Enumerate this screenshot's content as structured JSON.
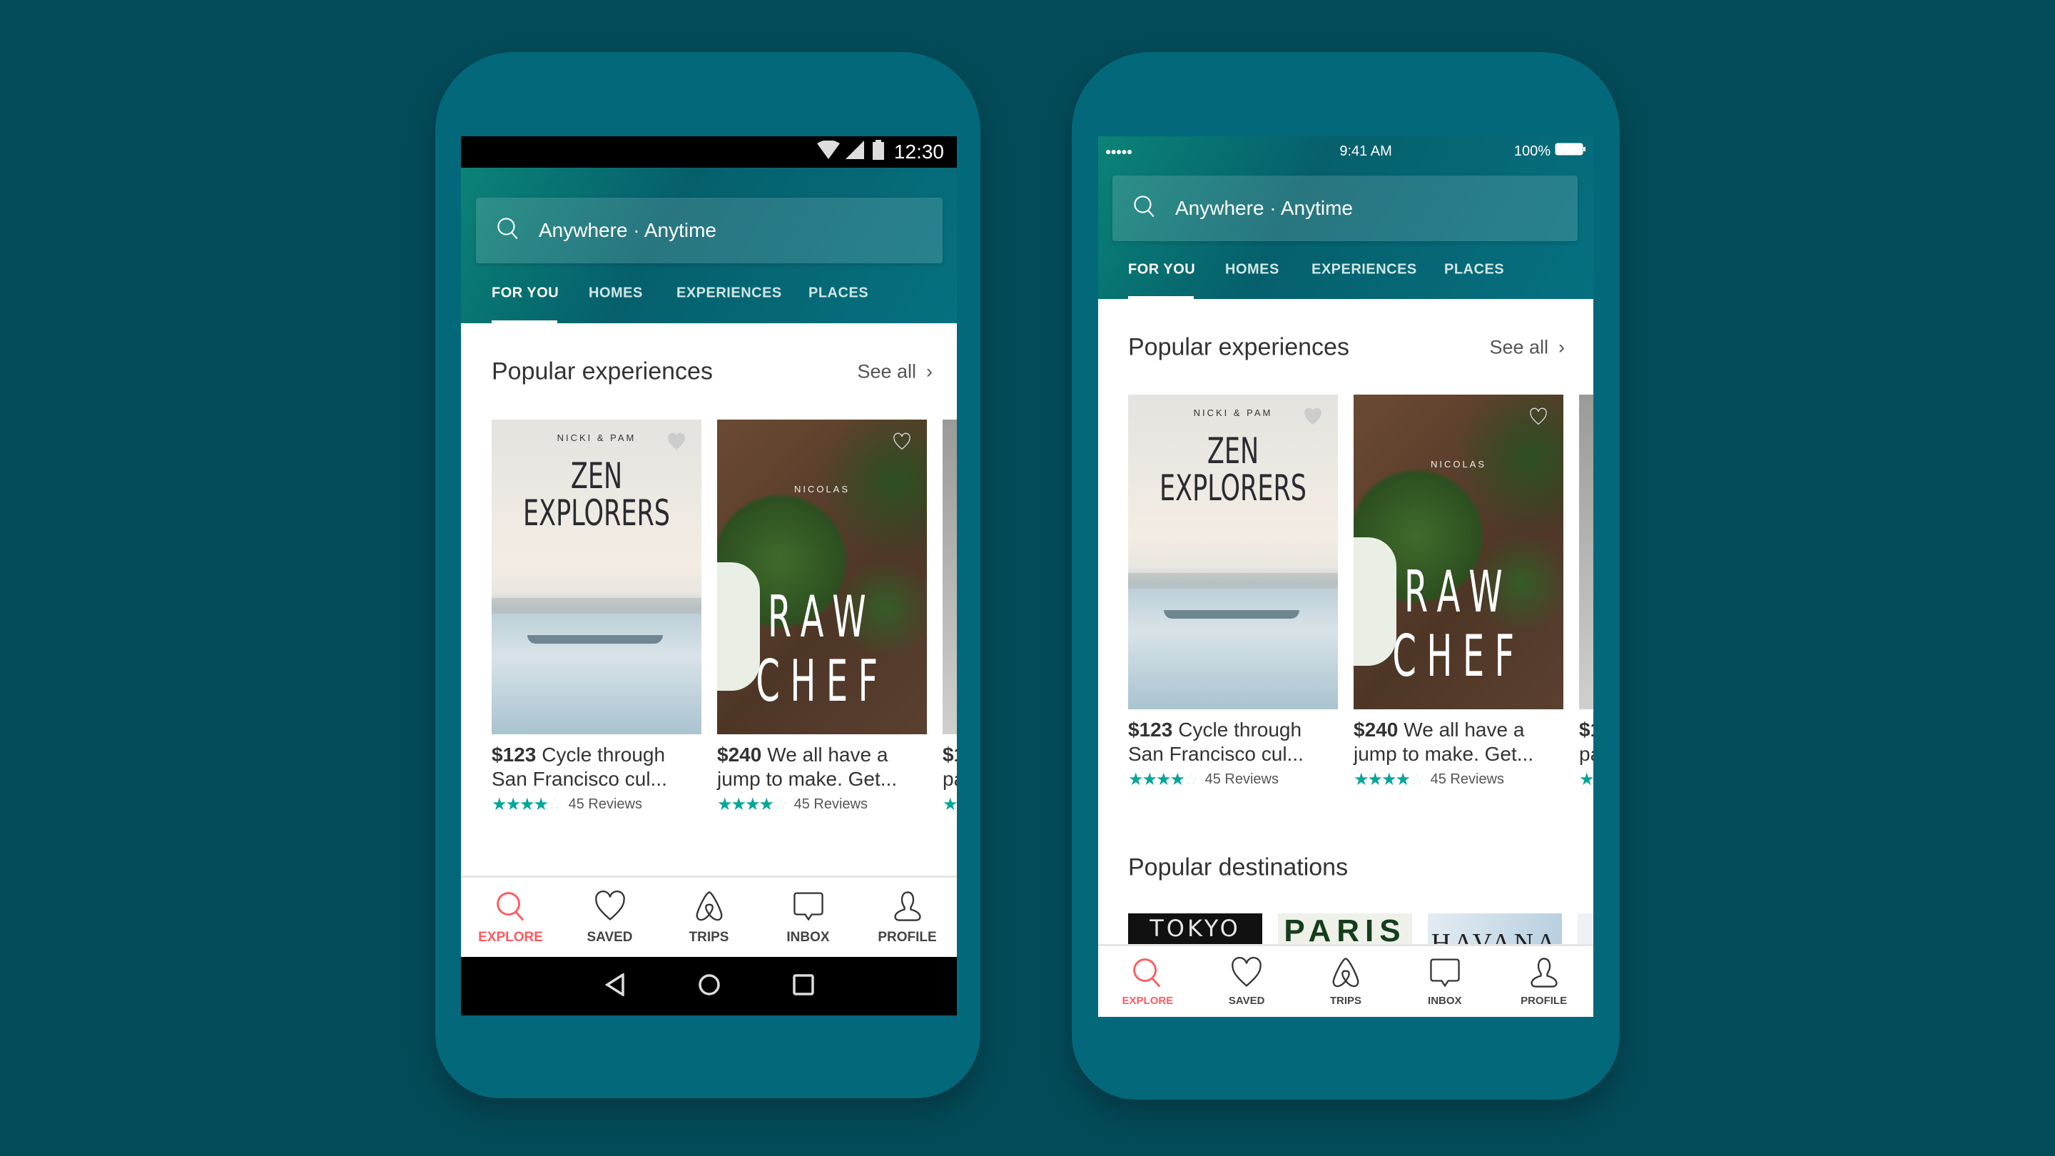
{
  "colors": {
    "background": "#044b59",
    "phone_body": "#03687a",
    "accent_teal": "#00a699",
    "explore_red": "#ff5a5f"
  },
  "android": {
    "status": {
      "time": "12:30",
      "icons": [
        "wifi-icon",
        "signal-icon",
        "battery-icon"
      ]
    },
    "search": {
      "placeholder": "Anywhere · Anytime"
    },
    "tabs": [
      {
        "label": "FOR YOU",
        "active": true
      },
      {
        "label": "HOMES"
      },
      {
        "label": "EXPERIENCES"
      },
      {
        "label": "PLACES"
      }
    ],
    "section": {
      "title": "Popular experiences",
      "see_all": "See all"
    },
    "cards": [
      {
        "host": "NICKI & PAM",
        "title1": "ZEN",
        "title2": "EXPLORERS",
        "price": "$123",
        "line1": "Cycle through",
        "line2": "San Francisco cul...",
        "rating": 4,
        "reviews": "45 Reviews"
      },
      {
        "host": "NICOLAS",
        "title1": "RAW",
        "title2": "CHEF",
        "price": "$240",
        "line1": "We all have a",
        "line2": "jump to make. Get...",
        "rating": 4,
        "reviews": "45 Reviews"
      },
      {
        "price": "$1",
        "line1": "",
        "line2": "pa",
        "rating": 1
      }
    ],
    "nav": [
      {
        "label": "EXPLORE",
        "icon": "search-icon",
        "active": true
      },
      {
        "label": "SAVED",
        "icon": "heart-icon"
      },
      {
        "label": "TRIPS",
        "icon": "airbnb-logo-icon"
      },
      {
        "label": "INBOX",
        "icon": "chat-bubble-icon"
      },
      {
        "label": "PROFILE",
        "icon": "person-icon"
      }
    ],
    "system_nav": [
      "back-icon",
      "home-icon",
      "recents-icon"
    ]
  },
  "ios": {
    "status": {
      "signal": "●●●●●",
      "time": "9:41 AM",
      "battery": "100%"
    },
    "search": {
      "placeholder": "Anywhere · Anytime"
    },
    "tabs": [
      {
        "label": "FOR YOU",
        "active": true
      },
      {
        "label": "HOMES"
      },
      {
        "label": "EXPERIENCES"
      },
      {
        "label": "PLACES"
      }
    ],
    "section": {
      "title": "Popular experiences",
      "see_all": "See all"
    },
    "cards": [
      {
        "host": "NICKI & PAM",
        "title1": "ZEN",
        "title2": "EXPLORERS",
        "price": "$123",
        "line1": "Cycle through",
        "line2": "San Francisco cul...",
        "rating": 4,
        "reviews": "45 Reviews"
      },
      {
        "host": "NICOLAS",
        "title1": "RAW",
        "title2": "CHEF",
        "price": "$240",
        "line1": "We all have a",
        "line2": "jump to make. Get...",
        "rating": 4,
        "reviews": "45 Reviews"
      },
      {
        "price": "$1",
        "line1": "",
        "line2": "pa",
        "rating": 1
      }
    ],
    "destinations": {
      "title": "Popular destinations",
      "items": [
        "TOKYO",
        "PARIS",
        "HAVANA"
      ]
    },
    "nav": [
      {
        "label": "EXPLORE",
        "icon": "search-icon",
        "active": true
      },
      {
        "label": "SAVED",
        "icon": "heart-icon"
      },
      {
        "label": "TRIPS",
        "icon": "airbnb-logo-icon"
      },
      {
        "label": "INBOX",
        "icon": "chat-bubble-icon"
      },
      {
        "label": "PROFILE",
        "icon": "person-icon"
      }
    ]
  }
}
